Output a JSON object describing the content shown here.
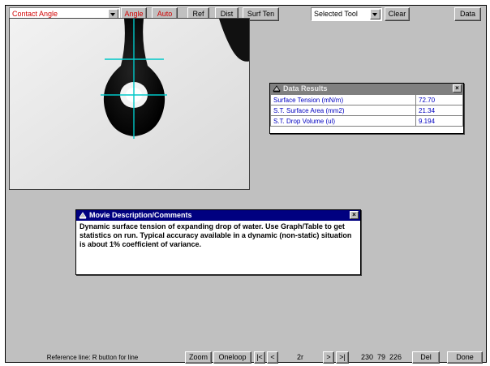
{
  "toolbar": {
    "measure_select": {
      "value": "Contact Angle"
    },
    "angle_label": "Angle",
    "auto_label": "Auto",
    "ref_label": "Ref",
    "dist_label": "Dist",
    "surf_ten_label": "Surf Ten",
    "tool_select": {
      "value": "Selected Tool"
    },
    "clear_label": "Clear",
    "data_label": "Data"
  },
  "data_results": {
    "title": "Data Results",
    "rows": [
      {
        "label": "Surface Tension (mN/m)",
        "value": "72.70"
      },
      {
        "label": "S.T. Surface Area (mm2)",
        "value": "21.34"
      },
      {
        "label": "S.T. Drop Volume (ul)",
        "value": "9.194"
      }
    ]
  },
  "movie_description": {
    "title": "Movie Description/Comments",
    "text": "Dynamic surface tension of expanding drop of water.  Use Graph/Table to get statistics on run.  Typical accuracy available in a dynamic (non-static) situation is about 1% coefficient of variance."
  },
  "status_bar": {
    "hint": "Reference line: R button for line",
    "zoom_label": "Zoom",
    "oneloop_label": "Oneloop",
    "first_label": "|<",
    "prev_label": "<",
    "frame_value": "2r",
    "next_label": ">",
    "last_label": ">|",
    "readout": "230  79  226",
    "del_label": "Del",
    "done_label": "Done"
  },
  "colors": {
    "title_bar": "#000080",
    "accent_red": "#d00000",
    "data_blue": "#0000c0",
    "crosshair": "#00c8c8"
  }
}
